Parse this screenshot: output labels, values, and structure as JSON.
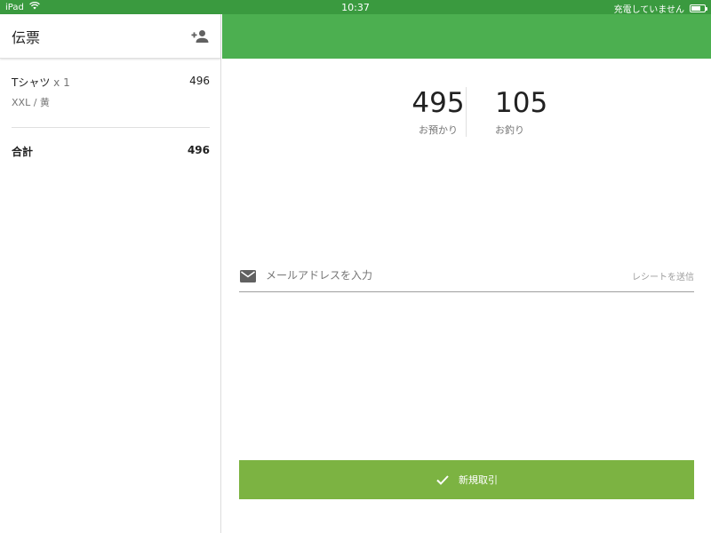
{
  "status_bar": {
    "device": "iPad",
    "time": "10:37",
    "charging_text": "充電していません",
    "icons": [
      "wifi-icon",
      "battery-icon"
    ]
  },
  "left_panel": {
    "title": "伝票",
    "add_customer_icon": "person-add-icon",
    "items": [
      {
        "name": "Tシャツ",
        "qty": "x 1",
        "price": "496",
        "variant": "XXL / 黄"
      }
    ],
    "total_label": "合計",
    "total_value": "496"
  },
  "payment": {
    "received_value": "495",
    "received_label": "お預かり",
    "change_value": "105",
    "change_label": "お釣り"
  },
  "email": {
    "icon": "mail-icon",
    "placeholder": "メールアドレスを入力",
    "value": "",
    "send_label": "レシートを送信"
  },
  "new_transaction": {
    "icon": "check-icon",
    "label": "新規取引"
  },
  "colors": {
    "status_bar": "#3a9a3f",
    "header_green": "#4caf50",
    "button_green": "#7cb342"
  }
}
